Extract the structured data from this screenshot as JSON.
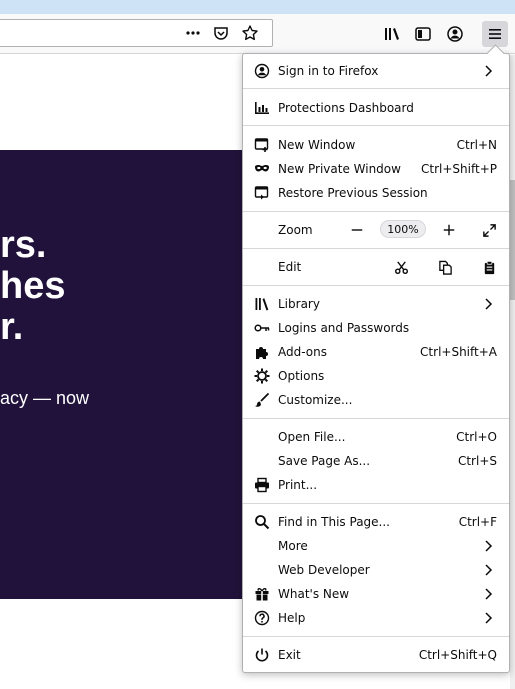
{
  "toolbar": {
    "urlbar_value": "",
    "icons": [
      "more-icon",
      "pocket-icon",
      "bookmark-star-icon",
      "library-icon",
      "sidebar-icon",
      "account-icon",
      "hamburger-menu-icon"
    ]
  },
  "webpage": {
    "hero_line1": "rs.",
    "hero_line2": "hes",
    "hero_line3": "r.",
    "hero_sub": "acy — now",
    "hero_color": "#20123a"
  },
  "menu": {
    "sign_in": "Sign in to Firefox",
    "protections": "Protections Dashboard",
    "new_window": "New Window",
    "new_window_sc": "Ctrl+N",
    "new_private": "New Private Window",
    "new_private_sc": "Ctrl+Shift+P",
    "restore": "Restore Previous Session",
    "zoom": "Zoom",
    "zoom_value": "100%",
    "edit": "Edit",
    "library": "Library",
    "logins": "Logins and Passwords",
    "addons": "Add-ons",
    "addons_sc": "Ctrl+Shift+A",
    "options": "Options",
    "customize": "Customize...",
    "open_file": "Open File...",
    "open_file_sc": "Ctrl+O",
    "save_page": "Save Page As...",
    "save_page_sc": "Ctrl+S",
    "print": "Print...",
    "find": "Find in This Page...",
    "find_sc": "Ctrl+F",
    "more": "More",
    "web_dev": "Web Developer",
    "whats_new": "What's New",
    "help": "Help",
    "exit": "Exit",
    "exit_sc": "Ctrl+Shift+Q"
  }
}
